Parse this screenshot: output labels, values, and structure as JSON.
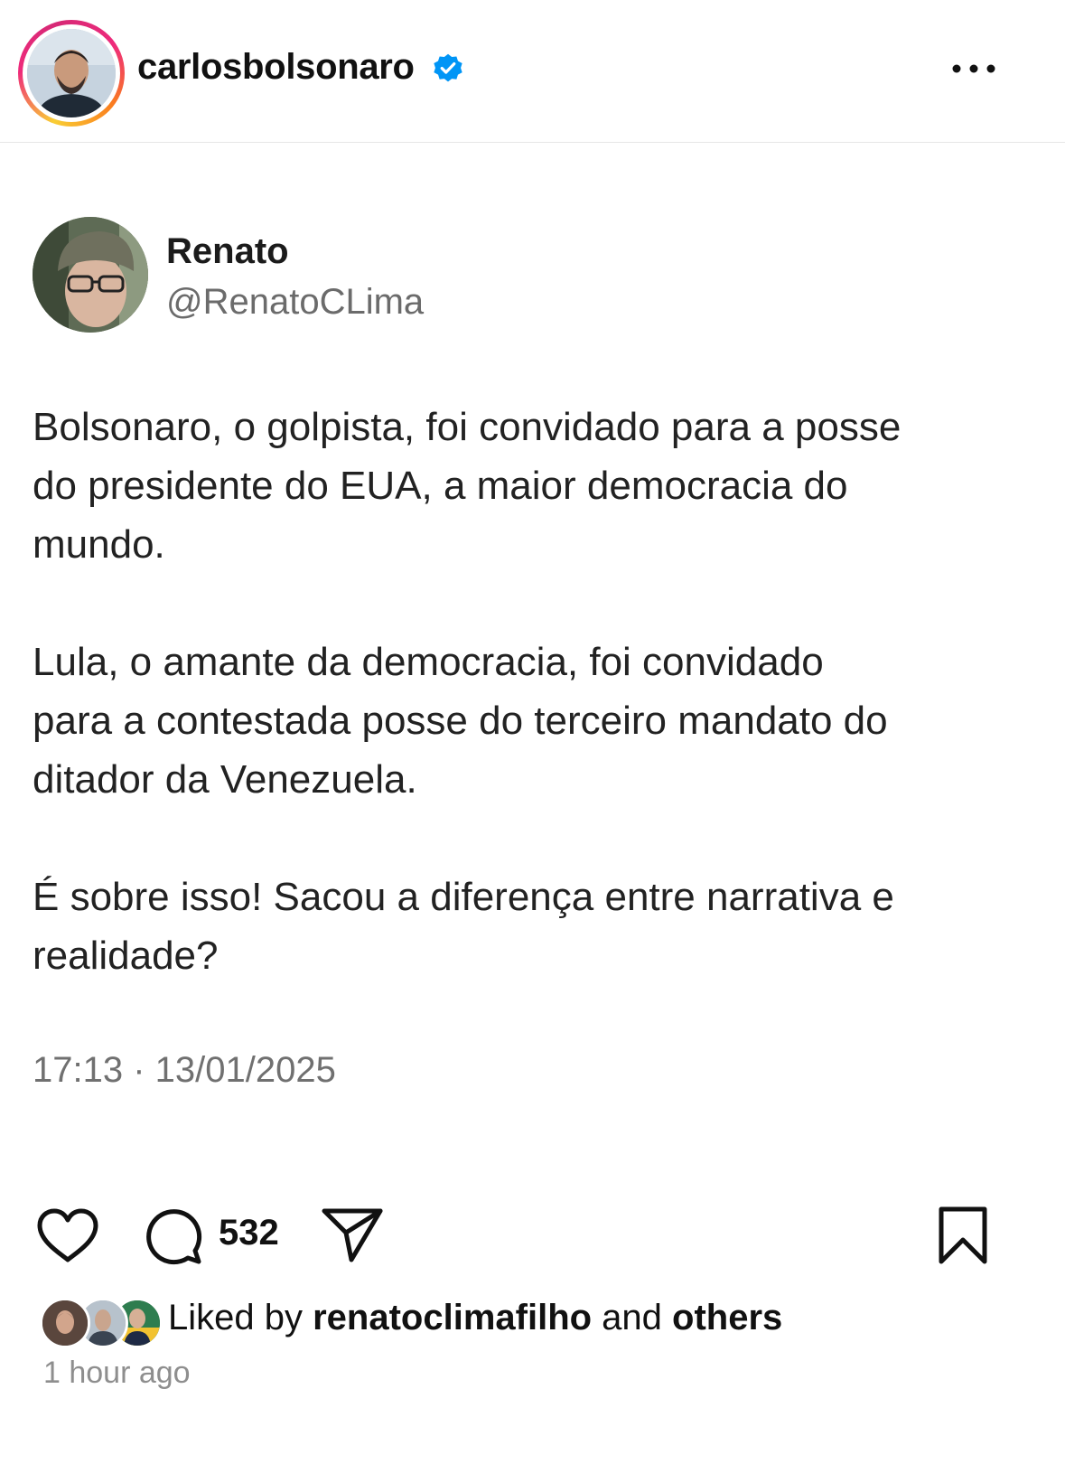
{
  "post": {
    "owner_username": "carlosbolsonaro",
    "icons": {
      "verified": "verified-badge-icon",
      "more": "more-options-icon",
      "like": "heart-icon",
      "comment": "comment-icon",
      "share": "send-icon",
      "save": "bookmark-icon"
    },
    "colors": {
      "verified": "#0095f6",
      "story_ring_start": "#f9ce34",
      "story_ring_end": "#ee2a7b"
    }
  },
  "tweet": {
    "author_name": "Renato",
    "author_handle": "@RenatoCLima",
    "paragraphs": [
      "Bolsonaro, o golpista, foi convidado para a posse\ndo presidente do EUA, a maior democracia do\nmundo.",
      "Lula, o amante da democracia, foi convidado\npara a contestada posse do terceiro mandato do\nditador da Venezuela.",
      "É sobre isso!  Sacou a diferença entre narrativa e\nrealidade?"
    ],
    "timestamp": "17:13 · 13/01/2025"
  },
  "actions": {
    "comment_count": "532"
  },
  "likes": {
    "prefix": "Liked by ",
    "user": "renatoclimafilho",
    "connector": " and ",
    "others": "others"
  },
  "time_ago": "1 hour ago"
}
